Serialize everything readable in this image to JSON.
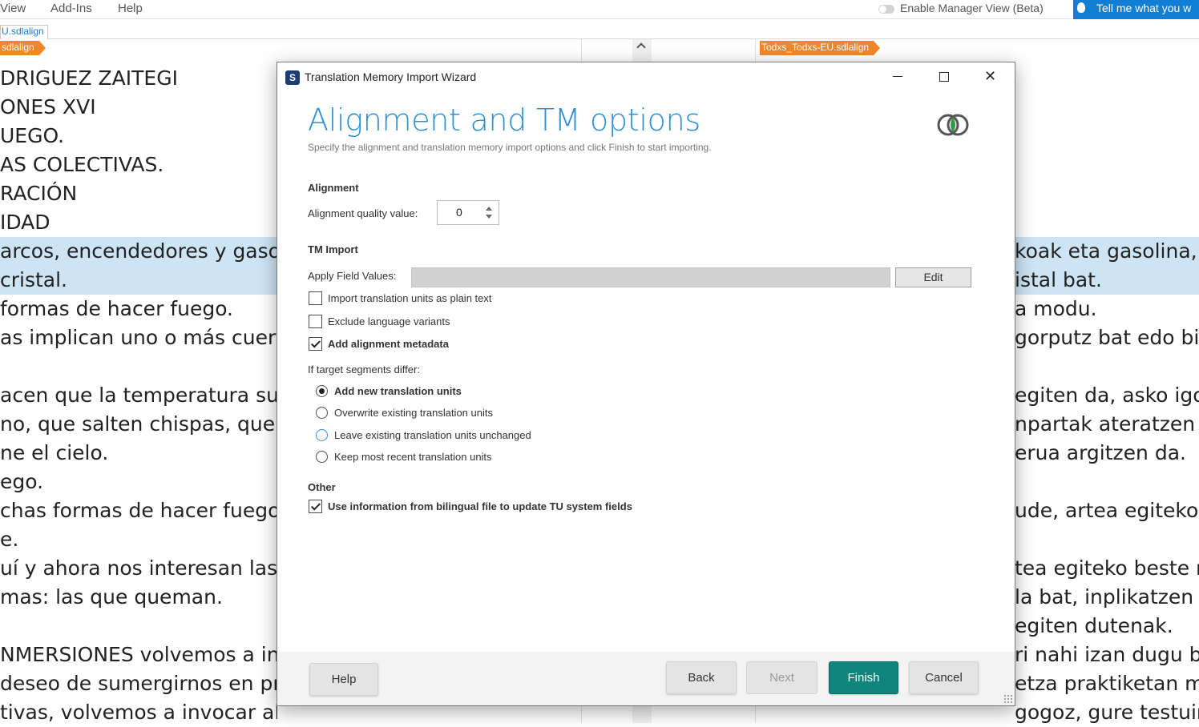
{
  "menu": {
    "view": "View",
    "addins": "Add-Ins",
    "help": "Help"
  },
  "manager_view_label": "Enable Manager View (Beta)",
  "tell_me": "Tell me what you w",
  "doc_tab": "U.sdlalign",
  "left_file_tag": "sdlalign",
  "right_file_tag": "Todxs_Todxs-EU.sdlalign",
  "left_lines": [
    "DRIGUEZ ZAITEGI",
    "ONES XVI",
    "UEGO.",
    "AS COLECTIVAS.",
    "RACIÓN",
    "IDAD",
    "arcos, encendedores y gasolin",
    "cristal.",
    "formas de hacer fuego.",
    "as implican uno o más cuerpo",
    "",
    "acen que la temperatura suba",
    "no, que salten chispas, que br",
    "ne el cielo.",
    "ego.",
    "chas formas de hacer fuego ig",
    "e.",
    "uí y ahora nos interesan las qu",
    "mas: las que queman.",
    "",
    "NMERSIONES volvemos a invo",
    " deseo de sumergirnos en prá",
    "tivas, volvemos a invocar al fuego desde el deseo de"
  ],
  "right_lines": [
    "",
    "",
    "",
    "",
    "",
    "",
    "koak eta gasolina, b",
    "istal bat.",
    "a modu.",
    "gorputz bat edo bi b",
    "",
    "egiten da, asko igo",
    "npartak ateratzen di",
    "erua argitzen da.",
    "",
    "ude, artea egiteko n",
    "",
    "tea egiteko beste m",
    "la bat, inplikatzen d",
    "egiten dutenak.",
    "ri nahi izan dugu be",
    "etza praktiketan mu",
    "gogoz, gure testuinguruan distira berriak eta p"
  ],
  "dialog": {
    "app_icon_letter": "S",
    "title": "Translation Memory Import Wizard",
    "close_glyph": "✕",
    "heading": "Alignment and TM options",
    "subtitle": "Specify the alignment and translation memory import options and click Finish to start importing.",
    "alignment": {
      "header": "Alignment",
      "quality_label": "Alignment quality value:",
      "quality_value": "0"
    },
    "tm_import": {
      "header": "TM Import",
      "apply_field_label": "Apply Field Values:",
      "apply_field_value": "",
      "edit_label": "Edit",
      "options": [
        {
          "label": "Import translation units as plain text",
          "checked": false
        },
        {
          "label": "Exclude language variants",
          "checked": false
        },
        {
          "label": "Add alignment metadata",
          "checked": true
        }
      ]
    },
    "differ": {
      "label": "If target segments differ:",
      "options": [
        {
          "label": "Add new translation units",
          "selected": true
        },
        {
          "label": "Overwrite existing translation units",
          "selected": false
        },
        {
          "label": "Leave existing translation units unchanged",
          "selected": false
        },
        {
          "label": "Keep most recent translation units",
          "selected": false
        }
      ]
    },
    "other": {
      "header": "Other",
      "option": {
        "label": "Use information from bilingual file to update TU system fields",
        "checked": true
      }
    },
    "buttons": {
      "help": "Help",
      "back": "Back",
      "next": "Next",
      "finish": "Finish",
      "cancel": "Cancel"
    }
  },
  "colors": {
    "heading_blue": "#2f8fd6",
    "primary_teal": "#10857d",
    "file_tag_orange": "#f0872b",
    "highlight_row": "#cde4f5",
    "tell_me_blue": "#0f7fd6"
  }
}
